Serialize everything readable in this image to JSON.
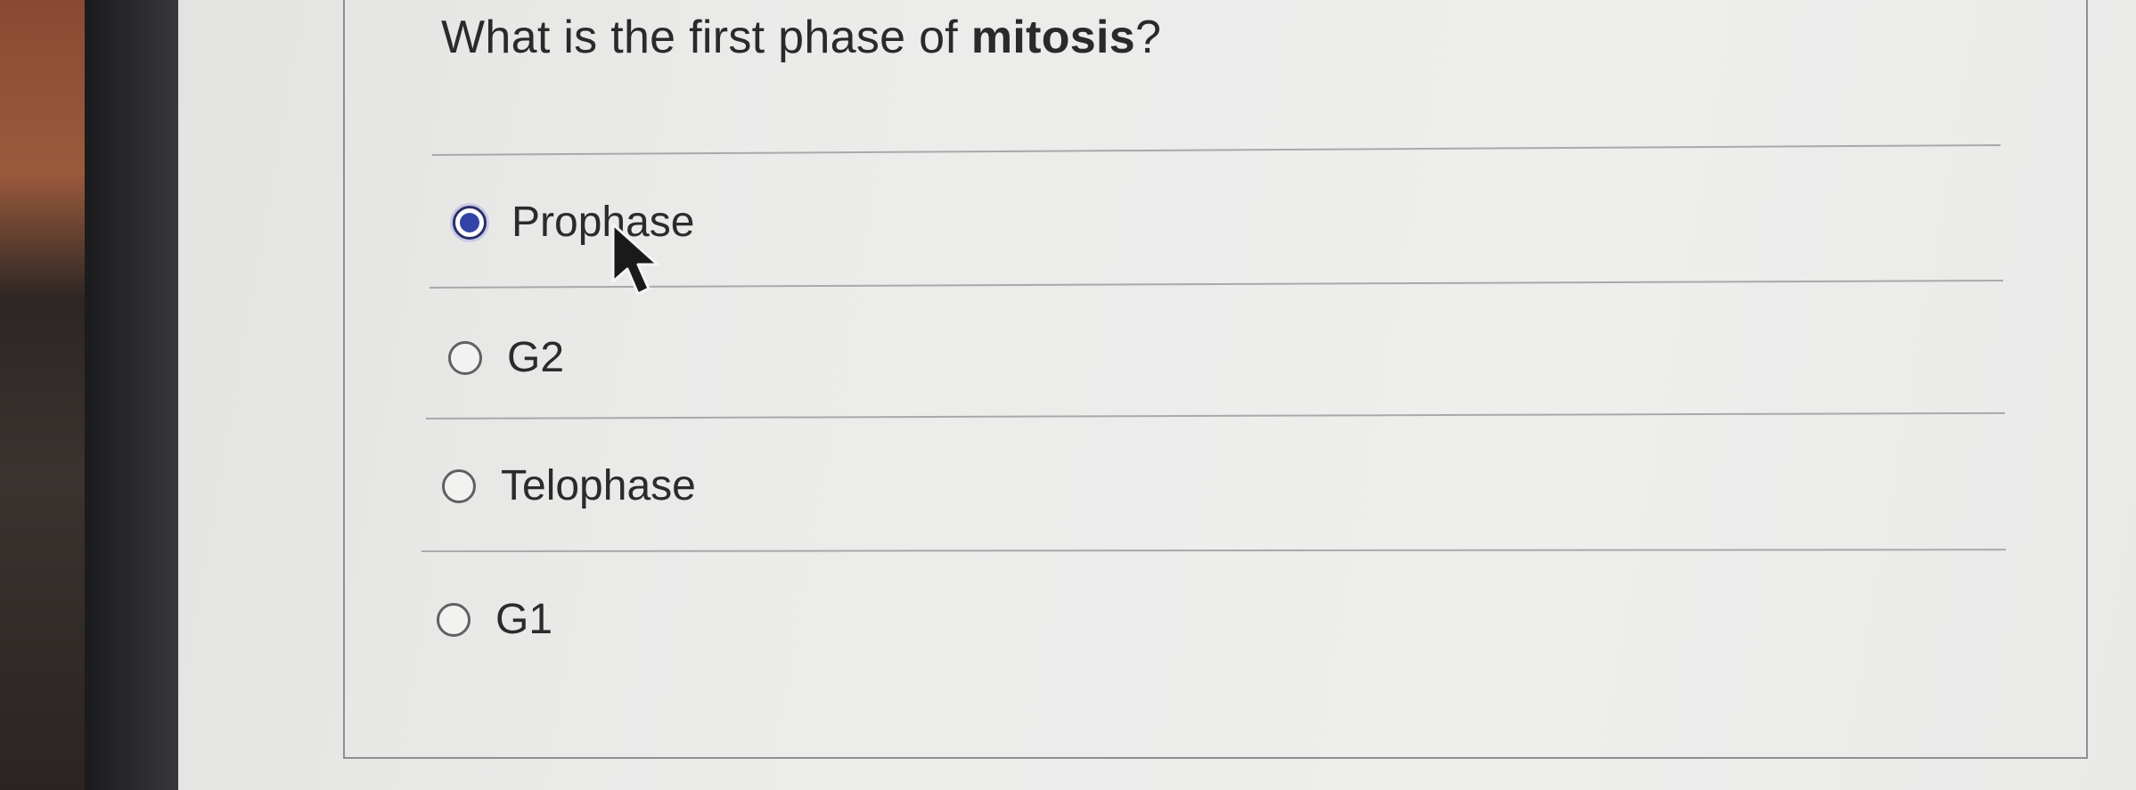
{
  "question": {
    "text_before": "What is the first phase of ",
    "text_bold": "mitosis",
    "text_after": "?"
  },
  "options": [
    {
      "label": "Prophase",
      "selected": true
    },
    {
      "label": "G2",
      "selected": false
    },
    {
      "label": "Telophase",
      "selected": false
    },
    {
      "label": "G1",
      "selected": false
    }
  ],
  "colors": {
    "selected_radio": "#3344a8",
    "text": "#2b2b2b",
    "divider": "#a9a9a9"
  },
  "icons": {
    "cursor": "mouse-pointer-icon"
  }
}
